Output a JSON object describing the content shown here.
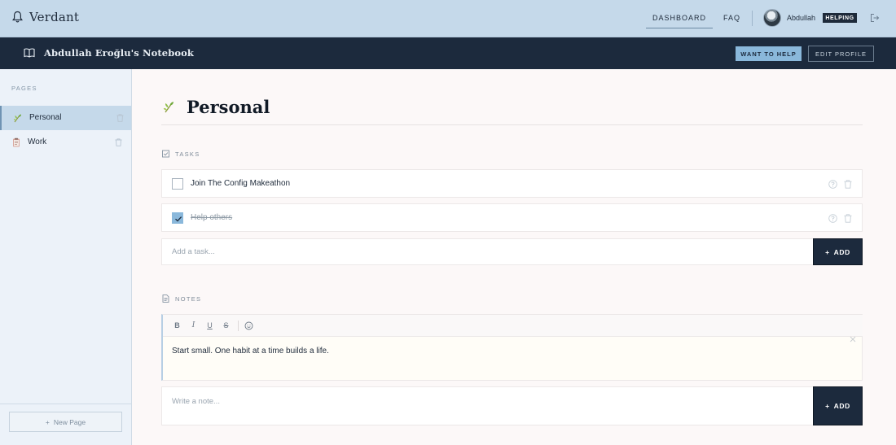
{
  "app": {
    "name": "Verdant",
    "icon": "bell-icon"
  },
  "nav": {
    "dashboard": "DASHBOARD",
    "faq": "FAQ"
  },
  "user": {
    "name": "Abdullah",
    "badge": "HELPING"
  },
  "notebook": {
    "title": "Abdullah Eroğlu's Notebook",
    "want_to_help": "WANT TO HELP",
    "edit_profile": "EDIT PROFILE"
  },
  "sidebar": {
    "heading": "PAGES",
    "items": [
      {
        "label": "Personal",
        "icon": "sprout-icon",
        "active": true
      },
      {
        "label": "Work",
        "icon": "clipboard-icon",
        "active": false
      }
    ],
    "new_page": "New Page"
  },
  "page": {
    "title": "Personal",
    "icon": "sprout-icon"
  },
  "tasks": {
    "heading": "TASKS",
    "items": [
      {
        "text": "Join The Config Makeathon",
        "done": false
      },
      {
        "text": "Help others",
        "done": true
      }
    ],
    "placeholder": "Add a task...",
    "add_label": "ADD"
  },
  "notes": {
    "heading": "NOTES",
    "toolbar": [
      "B",
      "I",
      "U",
      "S"
    ],
    "items": [
      {
        "text": "Start small. One habit at a time builds a life."
      }
    ],
    "placeholder": "Write a note...",
    "add_label": "ADD"
  },
  "colors": {
    "topbar": "#c5d9ea",
    "navy": "#1c2a3d",
    "accent": "#8ab8db",
    "sidebar": "#ecf2f9",
    "main_bg": "#fcf8f8"
  }
}
